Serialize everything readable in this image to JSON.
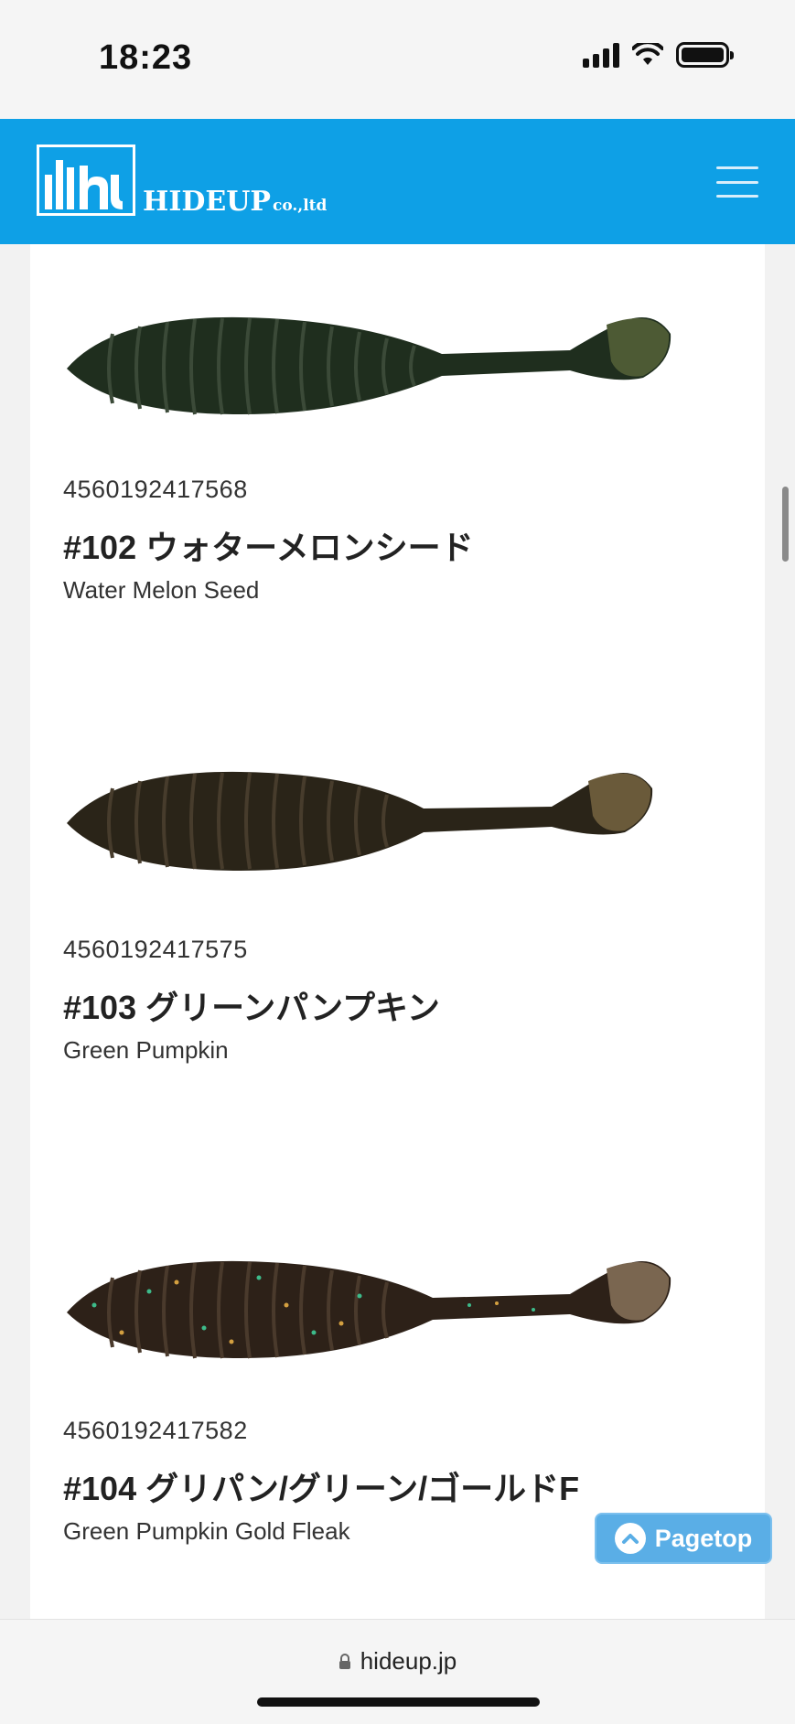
{
  "status_bar": {
    "time": "18:23"
  },
  "header": {
    "logo_text": "HIDEUP",
    "logo_sub": "co.,ltd"
  },
  "products": [
    {
      "code": "4560192417568",
      "name": "#102 ウォターメロンシード",
      "name_en": "Water Melon Seed",
      "body_color": "#1f2e1e",
      "tail_color": "#4d5a34"
    },
    {
      "code": "4560192417575",
      "name": "#103 グリーンパンプキン",
      "name_en": "Green Pumpkin",
      "body_color": "#2a2418",
      "tail_color": "#6a5a3a"
    },
    {
      "code": "4560192417582",
      "name": "#104 グリパン/グリーン/ゴールドF",
      "name_en": "Green Pumpkin Gold Fleak",
      "body_color": "#2d2118",
      "tail_color": "#7a6650"
    }
  ],
  "pagetop_label": "Pagetop",
  "url": "hideup.jp",
  "icons": {
    "signal": "signal-icon",
    "wifi": "wifi-icon",
    "battery": "battery-icon",
    "menu": "hamburger-menu-icon",
    "pagetop": "chevron-up-icon",
    "lock": "lock-icon"
  },
  "colors": {
    "brand_blue": "#0ea0e6",
    "pagetop_blue": "#5aaee6"
  }
}
